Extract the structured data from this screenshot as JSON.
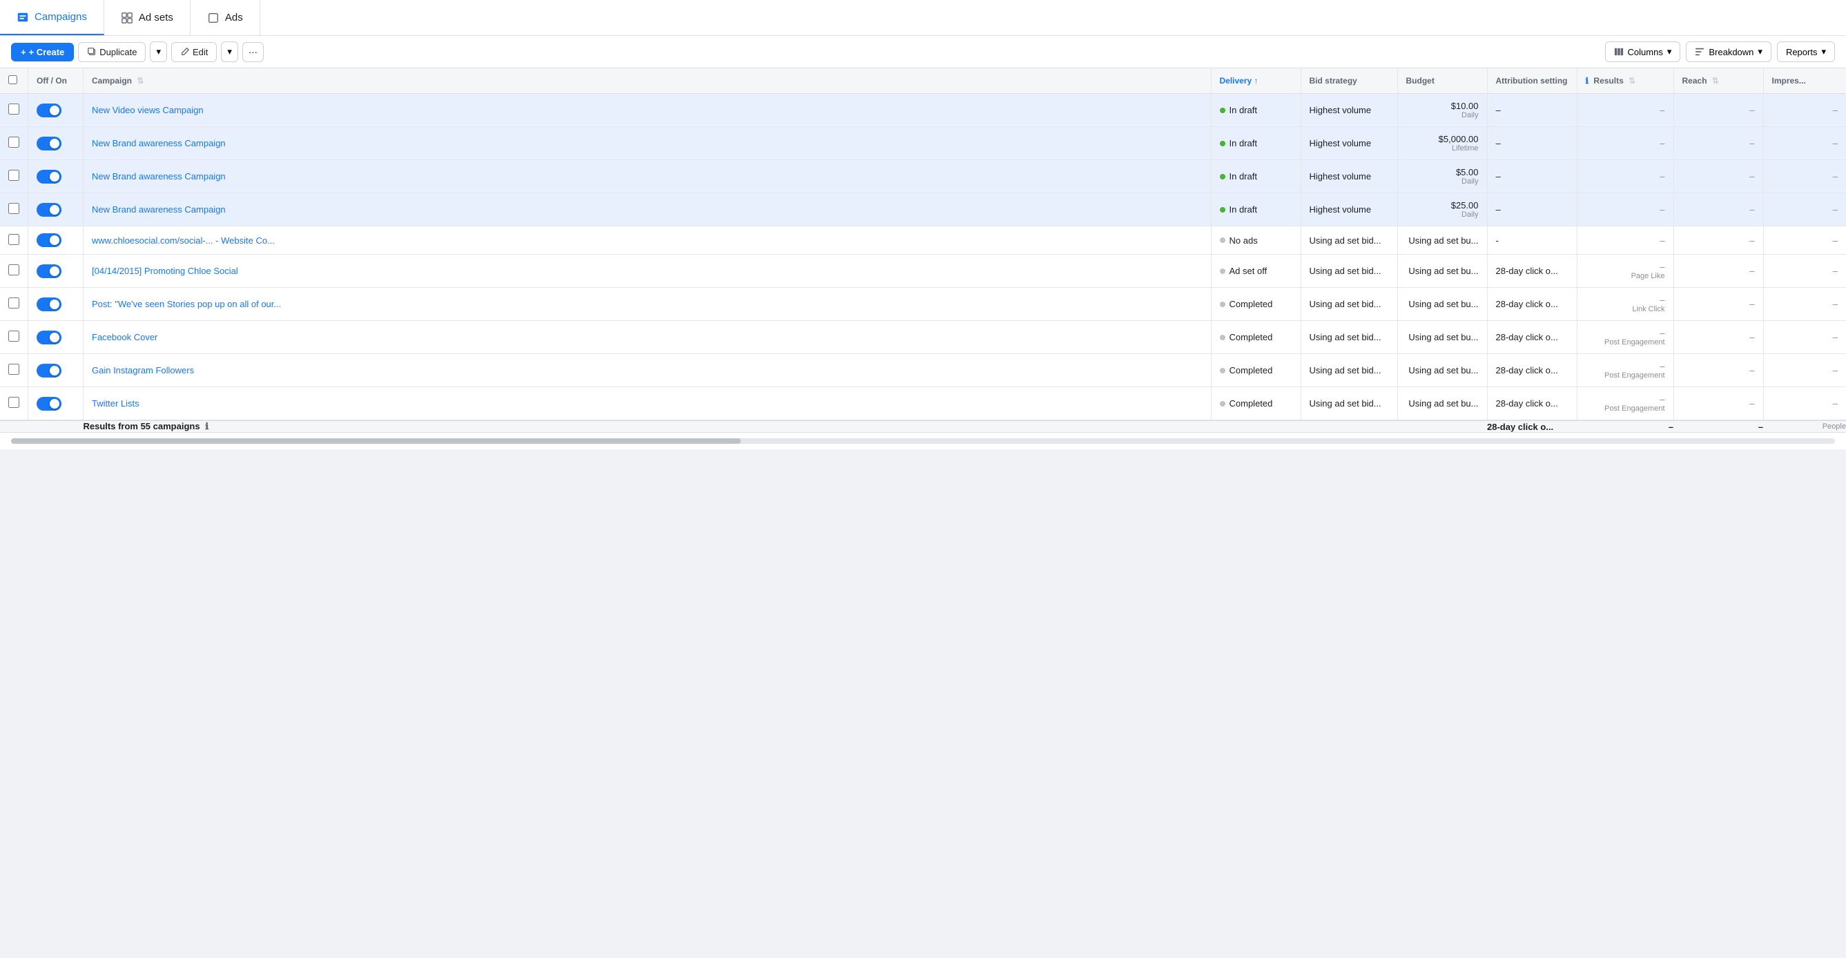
{
  "nav": {
    "tabs": [
      {
        "id": "campaigns",
        "label": "Campaigns",
        "icon": "flag",
        "active": true
      },
      {
        "id": "adsets",
        "label": "Ad sets",
        "icon": "grid",
        "active": false
      },
      {
        "id": "ads",
        "label": "Ads",
        "icon": "square",
        "active": false
      }
    ]
  },
  "toolbar": {
    "create_label": "+ Create",
    "duplicate_label": "Duplicate",
    "edit_label": "Edit",
    "more_label": "···",
    "columns_label": "Columns",
    "breakdown_label": "Breakdown",
    "reports_label": "Reports"
  },
  "table": {
    "headers": [
      {
        "id": "check",
        "label": ""
      },
      {
        "id": "toggle",
        "label": "Off / On"
      },
      {
        "id": "campaign",
        "label": "Campaign"
      },
      {
        "id": "delivery",
        "label": "Delivery ↑"
      },
      {
        "id": "bid",
        "label": "Bid strategy"
      },
      {
        "id": "budget",
        "label": "Budget"
      },
      {
        "id": "attribution",
        "label": "Attribution setting"
      },
      {
        "id": "results",
        "label": "Results"
      },
      {
        "id": "reach",
        "label": "Reach"
      },
      {
        "id": "impressions",
        "label": "Impres..."
      }
    ],
    "rows": [
      {
        "id": 1,
        "highlighted": true,
        "campaign": "New Video views Campaign",
        "delivery_status": "In draft",
        "delivery_dot": "green",
        "bid_strategy": "Highest volume",
        "budget_amount": "$10.00",
        "budget_period": "Daily",
        "attribution": "–",
        "results": "–",
        "results_sub": "",
        "reach": "–",
        "impressions": "–"
      },
      {
        "id": 2,
        "highlighted": true,
        "campaign": "New Brand awareness Campaign",
        "delivery_status": "In draft",
        "delivery_dot": "green",
        "bid_strategy": "Highest volume",
        "budget_amount": "$5,000.00",
        "budget_period": "Lifetime",
        "attribution": "–",
        "results": "–",
        "results_sub": "",
        "reach": "–",
        "impressions": "–"
      },
      {
        "id": 3,
        "highlighted": true,
        "campaign": "New Brand awareness Campaign",
        "delivery_status": "In draft",
        "delivery_dot": "green",
        "bid_strategy": "Highest volume",
        "budget_amount": "$5.00",
        "budget_period": "Daily",
        "attribution": "–",
        "results": "–",
        "results_sub": "",
        "reach": "–",
        "impressions": "–"
      },
      {
        "id": 4,
        "highlighted": true,
        "campaign": "New Brand awareness Campaign",
        "delivery_status": "In draft",
        "delivery_dot": "green",
        "bid_strategy": "Highest volume",
        "budget_amount": "$25.00",
        "budget_period": "Daily",
        "attribution": "–",
        "results": "–",
        "results_sub": "",
        "reach": "–",
        "impressions": "–"
      },
      {
        "id": 5,
        "highlighted": false,
        "campaign": "www.chloesocial.com/social-... - Website Co...",
        "delivery_status": "No ads",
        "delivery_dot": "gray",
        "bid_strategy": "Using ad set bid...",
        "budget_amount": "Using ad set bu...",
        "budget_period": "",
        "attribution": "-",
        "results": "–",
        "results_sub": "",
        "reach": "–",
        "impressions": "–"
      },
      {
        "id": 6,
        "highlighted": false,
        "campaign": "[04/14/2015] Promoting Chloe Social",
        "delivery_status": "Ad set off",
        "delivery_dot": "gray",
        "bid_strategy": "Using ad set bid...",
        "budget_amount": "Using ad set bu...",
        "budget_period": "",
        "attribution": "28-day click o...",
        "results": "–",
        "results_sub": "Page Like",
        "reach": "–",
        "impressions": "–"
      },
      {
        "id": 7,
        "highlighted": false,
        "campaign": "Post: \"We've seen Stories pop up on all of our...",
        "delivery_status": "Completed",
        "delivery_dot": "gray",
        "bid_strategy": "Using ad set bid...",
        "budget_amount": "Using ad set bu...",
        "budget_period": "",
        "attribution": "28-day click o...",
        "results": "–",
        "results_sub": "Link Click",
        "reach": "–",
        "impressions": "–"
      },
      {
        "id": 8,
        "highlighted": false,
        "campaign": "Facebook Cover",
        "delivery_status": "Completed",
        "delivery_dot": "gray",
        "bid_strategy": "Using ad set bid...",
        "budget_amount": "Using ad set bu...",
        "budget_period": "",
        "attribution": "28-day click o...",
        "results": "–",
        "results_sub": "Post Engagement",
        "reach": "–",
        "impressions": "–"
      },
      {
        "id": 9,
        "highlighted": false,
        "campaign": "Gain Instagram Followers",
        "delivery_status": "Completed",
        "delivery_dot": "gray",
        "bid_strategy": "Using ad set bid...",
        "budget_amount": "Using ad set bu...",
        "budget_period": "",
        "attribution": "28-day click o...",
        "results": "–",
        "results_sub": "Post Engagement",
        "reach": "–",
        "impressions": "–"
      },
      {
        "id": 10,
        "highlighted": false,
        "campaign": "Twitter Lists",
        "delivery_status": "Completed",
        "delivery_dot": "gray",
        "bid_strategy": "Using ad set bid...",
        "budget_amount": "Using ad set bu...",
        "budget_period": "",
        "attribution": "28-day click o...",
        "results": "–",
        "results_sub": "Post Engagement",
        "reach": "–",
        "impressions": "–"
      }
    ],
    "footer": {
      "label": "Results from 55 campaigns",
      "attribution": "28-day click o...",
      "results": "–",
      "reach": "–",
      "impressions": "People"
    }
  }
}
